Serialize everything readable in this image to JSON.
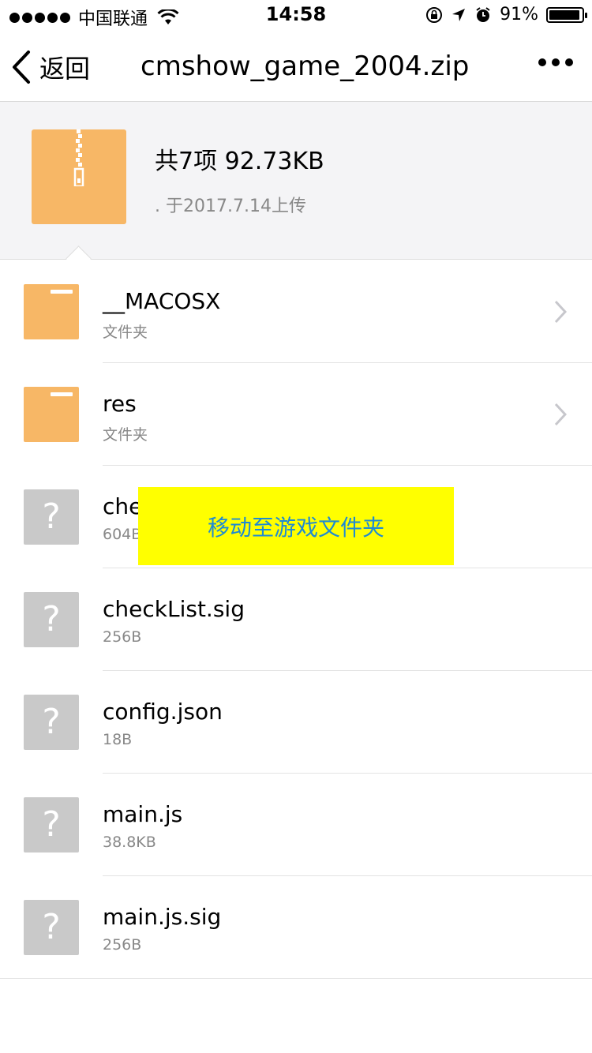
{
  "status_bar": {
    "carrier": "中国联通",
    "time": "14:58",
    "battery": "91%"
  },
  "nav": {
    "back_label": "返回",
    "title": "cmshow_game_2004.zip"
  },
  "header": {
    "summary": "共7项 92.73KB",
    "uploaded": ". 于2017.7.14上传"
  },
  "files": [
    {
      "name": "__MACOSX",
      "meta": "文件夹",
      "type": "folder"
    },
    {
      "name": "res",
      "meta": "文件夹",
      "type": "folder"
    },
    {
      "name": "checkList",
      "meta": "604B",
      "type": "unknown"
    },
    {
      "name": "checkList.sig",
      "meta": "256B",
      "type": "unknown"
    },
    {
      "name": "config.json",
      "meta": "18B",
      "type": "unknown"
    },
    {
      "name": "main.js",
      "meta": "38.8KB",
      "type": "unknown"
    },
    {
      "name": "main.js.sig",
      "meta": "256B",
      "type": "unknown"
    }
  ],
  "overlay": {
    "label": "移动至游戏文件夹"
  },
  "colors": {
    "folder": "#f7b766",
    "unknown_file": "#c9c9c9",
    "overlay_bg": "#ffff00",
    "overlay_text": "#1f8ad3"
  }
}
